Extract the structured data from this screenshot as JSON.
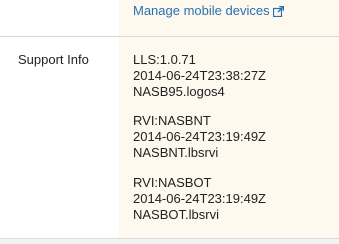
{
  "manage_link": {
    "label": "Manage mobile devices",
    "icon": "external-link-icon",
    "color": "#2a6fb3"
  },
  "support": {
    "label": "Support Info",
    "blocks": [
      {
        "line1": "LLS:1.0.71",
        "line2": "2014-06-24T23:38:27Z",
        "line3": "NASB95.logos4"
      },
      {
        "line1": "RVI:NASBNT",
        "line2": "2014-06-24T23:19:49Z",
        "line3": "NASBNT.lbsrvi"
      },
      {
        "line1": "RVI:NASBOT",
        "line2": "2014-06-24T23:19:49Z",
        "line3": "NASBOT.lbsrvi"
      }
    ]
  },
  "colors": {
    "panel_background": "#fdf9ee",
    "divider": "#d8d8d8"
  }
}
